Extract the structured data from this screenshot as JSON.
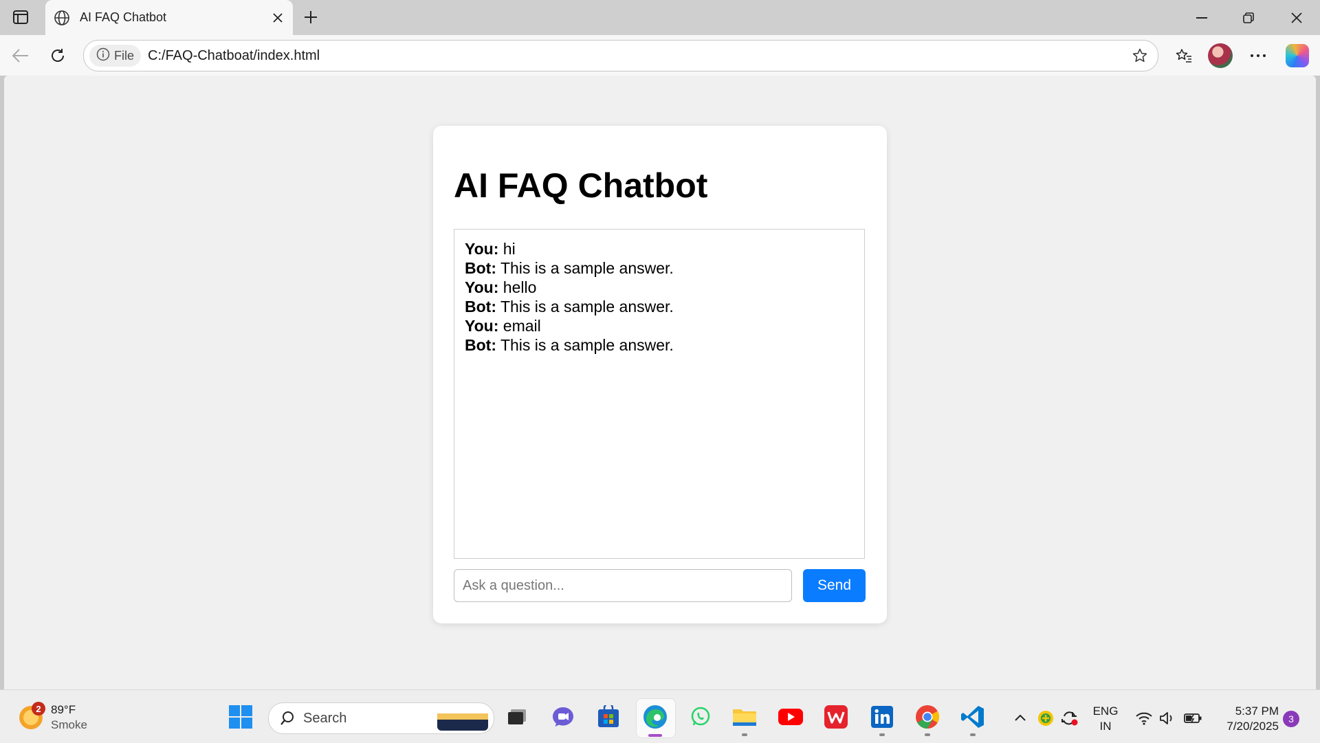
{
  "browser": {
    "tab_title": "AI FAQ Chatbot",
    "site_chip": "File",
    "url": "C:/FAQ-Chatboat/index.html"
  },
  "page": {
    "title": "AI FAQ Chatbot",
    "messages": [
      {
        "speaker": "You:",
        "text": "hi"
      },
      {
        "speaker": "Bot:",
        "text": "This is a sample answer."
      },
      {
        "speaker": "You:",
        "text": "hello"
      },
      {
        "speaker": "Bot:",
        "text": "This is a sample answer."
      },
      {
        "speaker": "You:",
        "text": "email"
      },
      {
        "speaker": "Bot:",
        "text": "This is a sample answer."
      }
    ],
    "input_placeholder": "Ask a question...",
    "input_value": "",
    "send_label": "Send",
    "accent_color": "#0a7cff"
  },
  "taskbar": {
    "weather_temp": "89°F",
    "weather_desc": "Smoke",
    "weather_badge": "2",
    "search_label": "Search",
    "lang_top": "ENG",
    "lang_bottom": "IN",
    "time": "5:37 PM",
    "date": "7/20/2025",
    "notification_count": "3"
  }
}
